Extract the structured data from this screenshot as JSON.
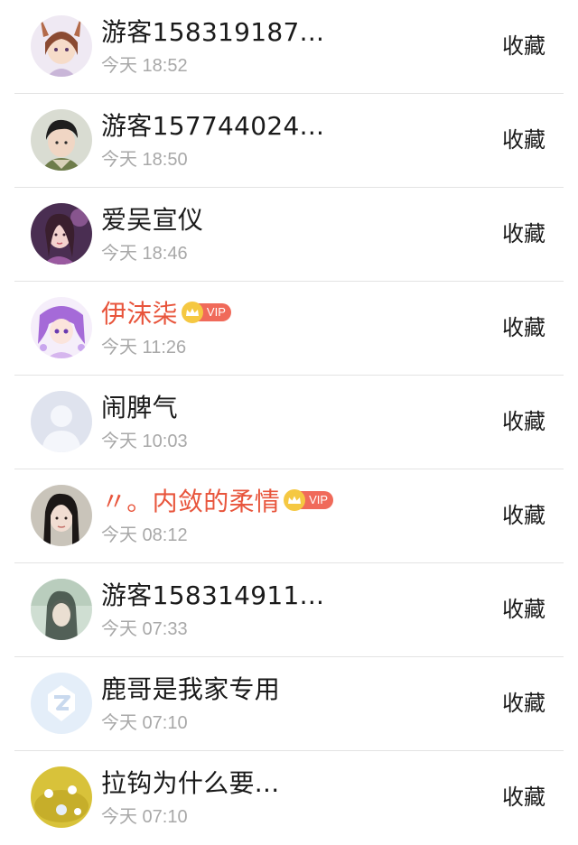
{
  "rows": [
    {
      "name": "游客158319187...",
      "time": "今天 18:52",
      "action": "收藏",
      "vip": false,
      "vip_label": ""
    },
    {
      "name": "游客157744024...",
      "time": "今天 18:50",
      "action": "收藏",
      "vip": false,
      "vip_label": ""
    },
    {
      "name": "爱吴宣仪",
      "time": "今天 18:46",
      "action": "收藏",
      "vip": false,
      "vip_label": ""
    },
    {
      "name": "伊沫柒",
      "time": "今天 11:26",
      "action": "收藏",
      "vip": true,
      "vip_label": "VIP"
    },
    {
      "name": "闹脾气",
      "time": "今天 10:03",
      "action": "收藏",
      "vip": false,
      "vip_label": ""
    },
    {
      "name": "〃。内敛的柔情",
      "time": "今天 08:12",
      "action": "收藏",
      "vip": true,
      "vip_label": "VIP"
    },
    {
      "name": "游客158314911...",
      "time": "今天 07:33",
      "action": "收藏",
      "vip": false,
      "vip_label": ""
    },
    {
      "name": "鹿哥是我家专用",
      "time": "今天 07:10",
      "action": "收藏",
      "vip": false,
      "vip_label": ""
    },
    {
      "name": "拉钩为什么要...",
      "time": "今天 07:10",
      "action": "收藏",
      "vip": false,
      "vip_label": ""
    }
  ],
  "colors": {
    "vip_name": "#e8553c",
    "vip_pill": "#f06a5a",
    "vip_crown": "#f5c842",
    "time": "#a8a8a8",
    "divider": "#e3e3e3"
  }
}
